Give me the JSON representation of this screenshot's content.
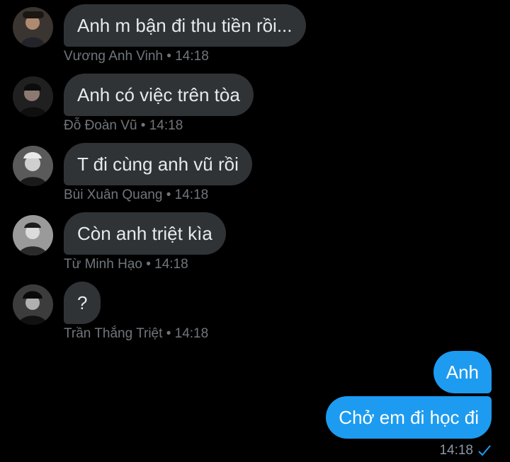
{
  "messages_in": [
    {
      "text": "Anh m bận đi thu tiền rồi...",
      "sender": "Vương Anh Vinh",
      "time": "14:18",
      "avatar_icon": "avatar-photo"
    },
    {
      "text": "Anh có việc trên tòa",
      "sender": "Đỗ Đoàn Vũ",
      "time": "14:18",
      "avatar_icon": "avatar-photo"
    },
    {
      "text": "T đi cùng anh vũ rồi",
      "sender": "Bùi Xuân Quang",
      "time": "14:18",
      "avatar_icon": "avatar-photo"
    },
    {
      "text": "Còn anh triệt kìa",
      "sender": "Từ Minh Hạo",
      "time": "14:18",
      "avatar_icon": "avatar-photo"
    },
    {
      "text": "?",
      "sender": "Trần Thắng Triệt",
      "time": "14:18",
      "avatar_icon": "avatar-photo"
    }
  ],
  "messages_out": [
    {
      "text": "Anh"
    },
    {
      "text": "Chở em đi học đi"
    }
  ],
  "out_time": "14:18",
  "meta_separator": "•",
  "colors": {
    "background": "#000000",
    "incoming_bubble": "#2f3336",
    "outgoing_bubble": "#1d9bf0",
    "meta_text": "#71767b"
  }
}
